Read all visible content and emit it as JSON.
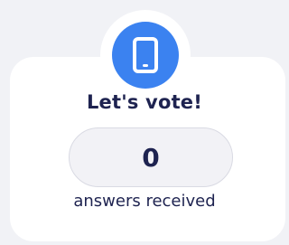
{
  "colors": {
    "background": "#f1f2f6",
    "card": "#ffffff",
    "accent": "#3b82f0",
    "text": "#1e2350",
    "counter_fill": "#f2f2f6",
    "counter_border": "#d9dae3"
  },
  "badge": {
    "icon": "smartphone-icon"
  },
  "title": "Let's vote!",
  "counter": {
    "value": "0"
  },
  "caption": "answers received"
}
